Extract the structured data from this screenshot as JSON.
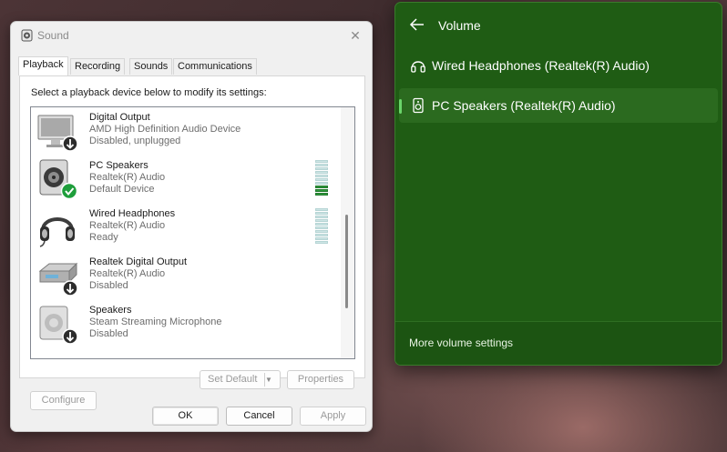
{
  "sound_dialog": {
    "title": "Sound",
    "close_glyph": "✕",
    "tabs": [
      {
        "label": "Playback"
      },
      {
        "label": "Recording"
      },
      {
        "label": "Sounds"
      },
      {
        "label": "Communications"
      }
    ],
    "instruction": "Select a playback device below to modify its settings:",
    "devices": [
      {
        "name": "Digital Output",
        "line1": "AMD High Definition Audio Device",
        "line2": "Disabled, unplugged",
        "icon": "monitor-icon",
        "badge": "disabled-badge-icon"
      },
      {
        "name": "PC Speakers",
        "line1": "Realtek(R) Audio",
        "line2": "Default Device",
        "icon": "speaker-icon",
        "badge": "default-check-icon",
        "meter_level": 0.25
      },
      {
        "name": "Wired Headphones",
        "line1": "Realtek(R) Audio",
        "line2": "Ready",
        "icon": "headphones-icon",
        "meter_level": 0
      },
      {
        "name": "Realtek Digital Output",
        "line1": "Realtek(R) Audio",
        "line2": "Disabled",
        "icon": "digital-output-icon",
        "badge": "disabled-badge-icon"
      },
      {
        "name": "Speakers",
        "line1": "Steam Streaming Microphone",
        "line2": "Disabled",
        "icon": "speaker-icon",
        "badge": "disabled-badge-icon"
      }
    ],
    "buttons": {
      "configure": "Configure",
      "set_default": "Set Default",
      "properties": "Properties",
      "ok": "OK",
      "cancel": "Cancel",
      "apply": "Apply"
    }
  },
  "volume_flyout": {
    "title": "Volume",
    "items": [
      {
        "label": "Wired Headphones (Realtek(R) Audio)",
        "icon": "headphones-icon",
        "selected": false
      },
      {
        "label": "PC Speakers (Realtek(R) Audio)",
        "icon": "speaker-icon",
        "selected": true
      }
    ],
    "more_settings": "More volume settings",
    "colors": {
      "background": "#1f5c14",
      "selected": "#2b6a1f",
      "accent": "#6bd66b"
    }
  }
}
